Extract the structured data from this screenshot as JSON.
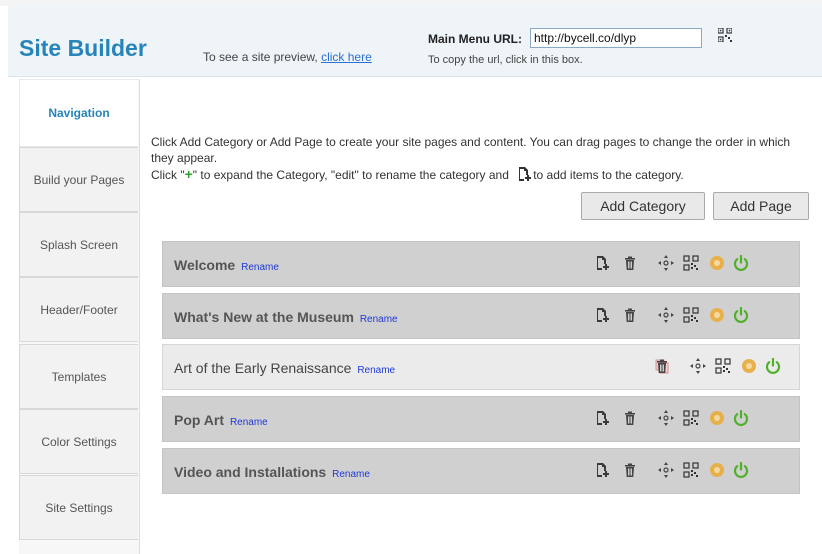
{
  "header": {
    "title": "Site Builder",
    "preview_prefix": "To see a site preview,",
    "preview_link": "click here",
    "url_label": "Main Menu URL:",
    "url_value": "http://bycell.co/dlyp",
    "url_hint": "To copy the url, click in this box."
  },
  "sidebar": {
    "items": [
      {
        "label": "Navigation",
        "active": true
      },
      {
        "label": "Build your Pages"
      },
      {
        "label": "Splash Screen"
      },
      {
        "label": "Header/Footer"
      },
      {
        "label": "Templates"
      },
      {
        "label": "Color Settings"
      },
      {
        "label": "Site Settings"
      }
    ]
  },
  "main": {
    "instructions_line1": "Click Add Category or Add Page to create your site pages and content. You can drag pages to change the order in which they appear.",
    "instr2_a": "Click \"",
    "instr2_plus": "+",
    "instr2_b": "\" to expand the Category, \"edit\" to rename the category and",
    "instr2_c": "to add items to the category.",
    "add_category": "Add Category",
    "add_page": "Add Page",
    "rename_label": "Rename",
    "rows": [
      {
        "title": "Welcome",
        "type": "category"
      },
      {
        "title": "What's New at the Museum",
        "type": "category"
      },
      {
        "title": "Art of the Early Renaissance",
        "type": "page"
      },
      {
        "title": "Pop Art",
        "type": "category"
      },
      {
        "title": "Video and Installations",
        "type": "category"
      }
    ]
  },
  "colors": {
    "brand": "#2784b8",
    "link": "#1f3ad8",
    "power_green": "#4fb02a",
    "status_orange": "#e8b04a"
  }
}
